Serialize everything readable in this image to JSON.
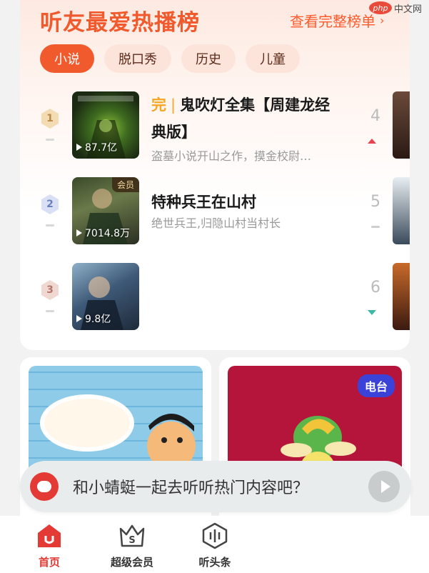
{
  "header": {
    "title": "听友最爱热播榜",
    "more_label": "查看完整榜单",
    "watermark_logo": "php",
    "watermark_text": "中文网"
  },
  "tabs": [
    {
      "label": "小说",
      "active": true
    },
    {
      "label": "脱口秀",
      "active": false
    },
    {
      "label": "历史",
      "active": false
    },
    {
      "label": "儿童",
      "active": false
    }
  ],
  "rankings": [
    {
      "rank": "1",
      "done_tag": "完",
      "title": "鬼吹灯全集【周建龙经典版】",
      "description": "盗墓小说开山之作，摸金校尉…",
      "plays": "87.7亿",
      "vip": "",
      "right_rank": "4",
      "trend": "up"
    },
    {
      "rank": "2",
      "done_tag": "",
      "title": "特种兵王在山村",
      "description": "绝世兵王,归隐山村当村长",
      "plays": "7014.8万",
      "vip": "会员",
      "right_rank": "5",
      "trend": "flat"
    },
    {
      "rank": "3",
      "done_tag": "",
      "title": "",
      "description": "",
      "plays": "9.8亿",
      "vip": "",
      "right_rank": "6",
      "trend": "down"
    }
  ],
  "promos": {
    "left_alt": "米小圈上学记",
    "right_badge": "电台"
  },
  "assistant": {
    "text": "和小蜻蜓一起去听听热门内容吧？"
  },
  "bottom_nav": [
    {
      "label": "首页",
      "icon": "home-icon",
      "active": true
    },
    {
      "label": "超级会员",
      "icon": "vip-crown-icon",
      "active": false
    },
    {
      "label": "听头条",
      "icon": "headline-audio-icon",
      "active": false
    }
  ],
  "colors": {
    "accent": "#f05a2c",
    "brand_red": "#e33a35",
    "trend_up": "#e8424d",
    "trend_down": "#3cb8a5",
    "radio_badge": "#3a42d8"
  }
}
